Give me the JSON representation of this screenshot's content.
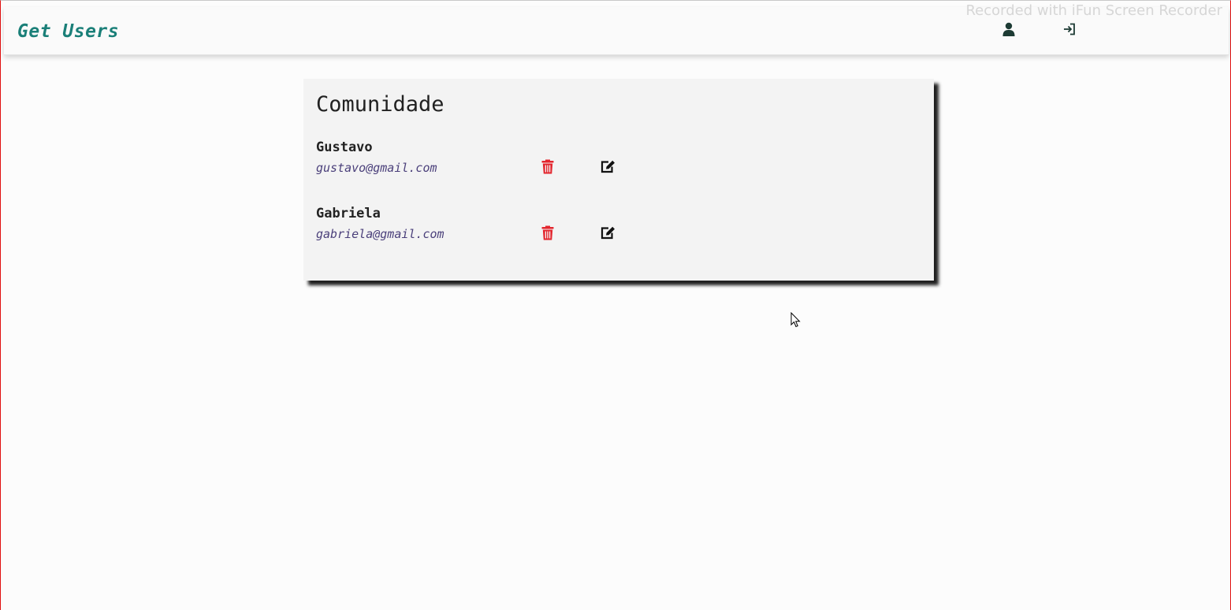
{
  "app": {
    "title": "Get Users",
    "watermark": "Recorded with iFun Screen Recorder",
    "accent_color": "#1a7f78"
  },
  "nav": {
    "profile_icon": "user-icon",
    "logout_icon": "sign-in-icon"
  },
  "community": {
    "title": "Comunidade",
    "users": [
      {
        "name": "Gustavo",
        "email": "gustavo@gmail.com",
        "delete_icon": "trash-icon",
        "edit_icon": "edit-icon"
      },
      {
        "name": "Gabriela",
        "email": "gabriela@gmail.com",
        "delete_icon": "trash-icon",
        "edit_icon": "edit-icon"
      }
    ],
    "delete_color": "#e3262e",
    "edit_color": "#111111"
  }
}
